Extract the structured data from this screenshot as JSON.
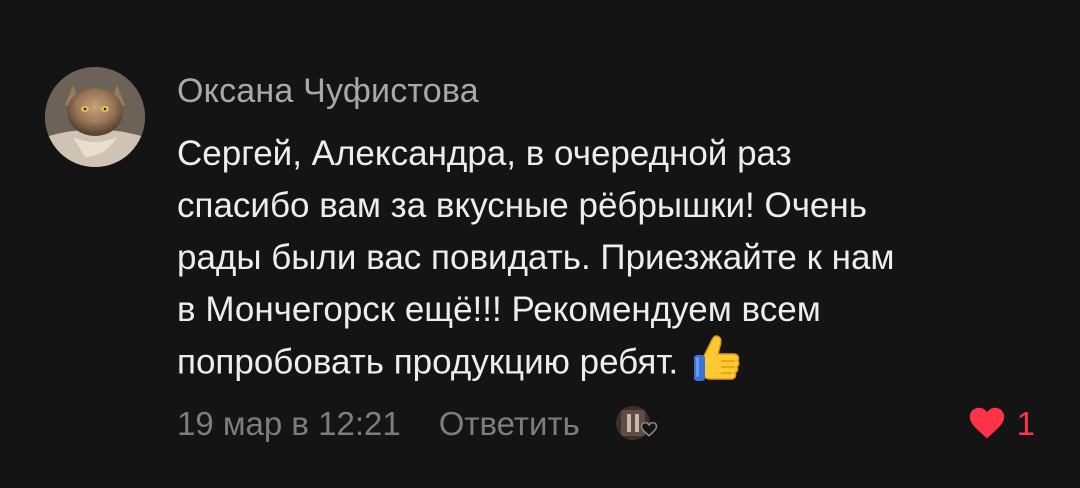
{
  "comment": {
    "author": "Оксана Чуфистова",
    "text_lines": [
      "Сергей, Александра, в очередной раз",
      "спасибо вам за вкусные рёбрышки! Очень",
      "рады были вас повидать. Приезжайте к нам",
      "в Мончегорск ещё!!!  Рекомендуем всем",
      "попробовать продукцию ребят."
    ],
    "emoji": "thumbs-up-icon",
    "timestamp": "19 мар в 12:21",
    "reply_label": "Ответить",
    "like_count": "1",
    "liked": true
  },
  "colors": {
    "background": "#141414",
    "author": "#a8a8a8",
    "text": "#ededed",
    "meta": "#7d7d7d",
    "like": "#ff3347"
  },
  "icons": {
    "author_avatar": "avatar",
    "liked_by_avatar": "author-liked-avatar",
    "small_heart": "heart-outline-icon",
    "like_heart": "heart-filled-icon"
  }
}
